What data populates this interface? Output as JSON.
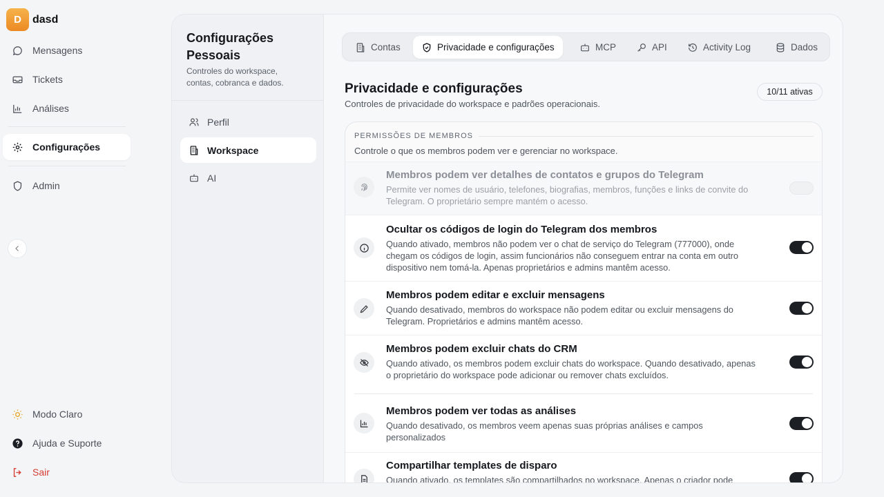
{
  "brand": {
    "initial": "D",
    "name": "dasd"
  },
  "sidebar": {
    "items": [
      {
        "label": "Mensagens",
        "icon": "message-icon"
      },
      {
        "label": "Tickets",
        "icon": "ticket-icon"
      },
      {
        "label": "Análises",
        "icon": "chart-icon"
      },
      {
        "label": "Configurações",
        "icon": "gear-icon"
      },
      {
        "label": "Admin",
        "icon": "shield-icon"
      }
    ],
    "theme_label": "Modo Claro",
    "help_label": "Ajuda e Suporte",
    "logout_label": "Sair"
  },
  "settings": {
    "title": "Configurações Pessoais",
    "description": "Controles do workspace, contas, cobranca e dados.",
    "items": [
      {
        "label": "Perfil"
      },
      {
        "label": "Workspace"
      },
      {
        "label": "AI"
      }
    ]
  },
  "tabs": [
    {
      "label": "Contas"
    },
    {
      "label": "Privacidade e configurações"
    },
    {
      "label": "MCP"
    },
    {
      "label": "API"
    },
    {
      "label": "Activity Log"
    },
    {
      "label": "Dados"
    }
  ],
  "section": {
    "title": "Privacidade e configurações",
    "subtitle": "Controles de privacidade do workspace e padrões operacionais.",
    "count": "10/11 ativas"
  },
  "permissions": {
    "heading": "PERMISSÕES DE MEMBROS",
    "description": "Controle o que os membros podem ver e gerenciar no workspace.",
    "rows": [
      {
        "title": "Membros podem ver detalhes de contatos e grupos do Telegram",
        "text": "Permite ver nomes de usuário, telefones, biografias, membros, funções e links de convite do Telegram. O proprietário sempre mantém o acesso.",
        "enabled": false,
        "icon": "fingerprint-icon"
      },
      {
        "title": "Ocultar os códigos de login do Telegram dos membros",
        "text": "Quando ativado, membros não podem ver o chat de serviço do Telegram (777000), onde chegam os códigos de login, assim funcionários não conseguem entrar na conta em outro dispositivo nem tomá-la. Apenas proprietários e admins mantêm acesso.",
        "enabled": true,
        "icon": "info-icon"
      },
      {
        "title": "Membros podem editar e excluir mensagens",
        "text": "Quando desativado, membros do workspace não podem editar ou excluir mensagens do Telegram. Proprietários e admins mantêm acesso.",
        "enabled": true,
        "icon": "pencil-icon"
      },
      {
        "title": "Membros podem excluir chats do CRM",
        "text": "Quando ativado, os membros podem excluir chats do workspace. Quando desativado, apenas o proprietário do workspace pode adicionar ou remover chats excluídos.",
        "enabled": true,
        "icon": "eye-off-icon"
      },
      {
        "title": "Membros podem ver todas as análises",
        "text": "Quando desativado, os membros veem apenas suas próprias análises e campos personalizados",
        "enabled": true,
        "icon": "chart-icon"
      },
      {
        "title": "Compartilhar templates de disparo",
        "text": "Quando ativado, os templates são compartilhados no workspace. Apenas o criador pode",
        "enabled": true,
        "icon": "document-icon"
      }
    ]
  }
}
